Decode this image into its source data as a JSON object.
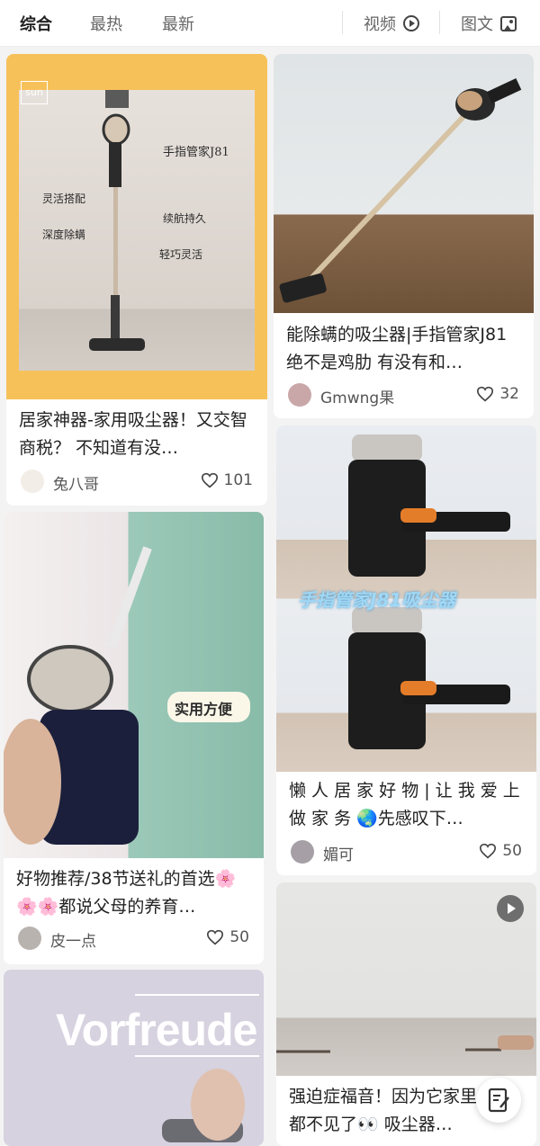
{
  "tabs": {
    "zonghe": "综合",
    "zuire": "最热",
    "zuixin": "最新",
    "video": "视频",
    "image_text": "图文"
  },
  "cards": [
    {
      "title": "居家神器-家用吸尘器！又交智商税？ 不知道有没…",
      "author": "兔八哥",
      "likes": "101",
      "image_text": {
        "logo": "sun",
        "label_brand": "手指管家J81",
        "label_1": "灵活搭配",
        "label_2": "深度除螨",
        "label_3": "续航持久",
        "label_4": "轻巧灵活"
      }
    },
    {
      "title": "能除螨的吸尘器|手指管家J81绝不是鸡肋 有没有和…",
      "author": "Gmwng果",
      "likes": "32"
    },
    {
      "title": "好物推荐/38节送礼的首选🌸🌸🌸都说父母的养育…",
      "author": "皮一点",
      "likes": "50",
      "image_text": {
        "sticker": "实用方便"
      }
    },
    {
      "title": "懒 人 居 家 好 物 | 让 我 爱 上 做 家 务 🌏先感叹下…",
      "author": "媚可",
      "likes": "50",
      "image_text": {
        "overlay": "手指管家J81吸尘器"
      }
    },
    {
      "title": "",
      "author": "",
      "likes": "",
      "image_text": {
        "word": "Vorfreude"
      }
    },
    {
      "title": "强迫症福音！因为它家里东西都不见了👀 吸尘器…",
      "author": "",
      "likes": ""
    }
  ],
  "colors": {
    "accent_yellow": "#f7c15a",
    "text_dark": "#222222",
    "text_muted": "#555555"
  },
  "icons": [
    "play-circle-icon",
    "image-icon",
    "heart-icon",
    "play-badge-icon",
    "edit-icon"
  ]
}
